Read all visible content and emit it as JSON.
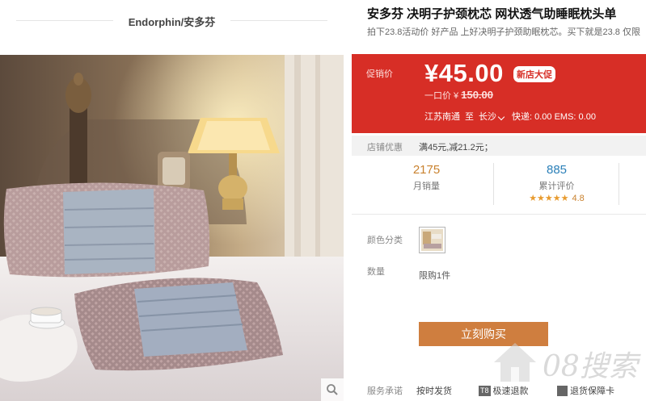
{
  "brand": {
    "name": "Endorphin/安多芬"
  },
  "product": {
    "title": "安多芬 决明子护颈枕芯 网状透气助睡眠枕头单",
    "subtitle": "拍下23.8活动价 好产品 上好决明子护颈助眠枕芯。买下就是23.8 仅限"
  },
  "price": {
    "label": "促销价",
    "value": "¥45.00",
    "promo_tag": "新店大促",
    "original_prefix": "一口价 ¥ ",
    "original_value": "150.00",
    "ship_from": "江苏南通",
    "ship_to_word": "至",
    "ship_to": "长沙",
    "shipping": "快递: 0.00 EMS: 0.00"
  },
  "discount": {
    "label": "店铺优惠",
    "text": "满45元,减21.2元；"
  },
  "stats": {
    "monthly_sales": "2175",
    "monthly_sales_label": "月销量",
    "reviews": "885",
    "reviews_label": "累计评价",
    "stars": "★★★★★",
    "rating": "4.8"
  },
  "options": {
    "color_label": "颜色分类",
    "quantity_label": "数量",
    "quantity_limit": "限购1件"
  },
  "buy_button": "立刻购买",
  "service": {
    "label": "服务承诺",
    "items": [
      {
        "badge": "",
        "text": "按时发货"
      },
      {
        "badge": "T8",
        "text": "极速退款"
      },
      {
        "badge": "",
        "text": "退货保障卡"
      }
    ]
  },
  "watermark": "08搜索",
  "colors": {
    "price_red": "#d72e26",
    "buy_button": "#cf7e3f",
    "sales_orange": "#c9822f",
    "review_blue": "#2a7fb8"
  }
}
